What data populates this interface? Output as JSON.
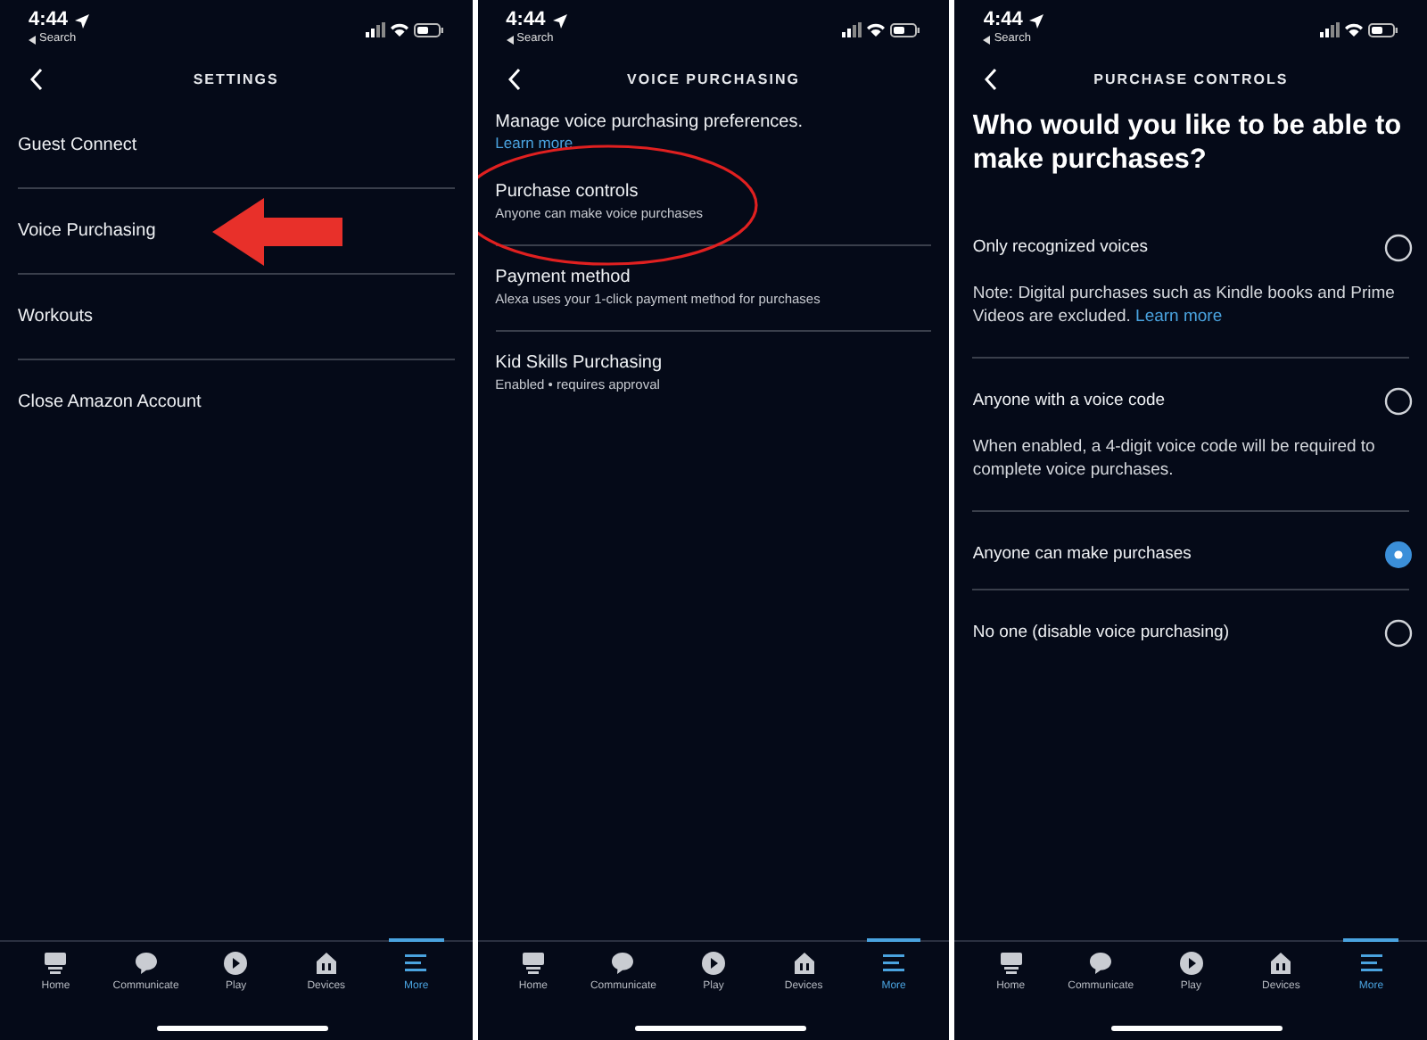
{
  "screens": [
    {
      "status": {
        "time": "4:44",
        "back_app": "Search"
      },
      "title": "SETTINGS",
      "blocks": [
        {
          "kind": "row",
          "title": "Guest Connect",
          "pointed_at": false
        },
        {
          "kind": "divider"
        },
        {
          "kind": "row",
          "title": "Voice Purchasing",
          "pointed_at": true
        },
        {
          "kind": "divider"
        },
        {
          "kind": "row",
          "title": "Workouts",
          "pointed_at": false
        },
        {
          "kind": "divider"
        },
        {
          "kind": "row",
          "title": "Close Amazon Account",
          "pointed_at": false
        }
      ],
      "tabs": [
        {
          "label": "Home",
          "kind": "home",
          "selected": false
        },
        {
          "label": "Communicate",
          "kind": "communicate",
          "selected": false
        },
        {
          "label": "Play",
          "kind": "play",
          "selected": false
        },
        {
          "label": "Devices",
          "kind": "devices",
          "selected": false
        },
        {
          "label": "More",
          "kind": "more",
          "selected": true
        }
      ]
    },
    {
      "status": {
        "time": "4:44",
        "back_app": "Search"
      },
      "title": "VOICE PURCHASING",
      "blocks": [
        {
          "kind": "intro",
          "text": "Manage voice purchasing preferences.",
          "link": "Learn more"
        },
        {
          "kind": "row",
          "title": "Purchase controls",
          "subtitle": "Anyone can make voice purchases",
          "circled": true
        },
        {
          "kind": "divider"
        },
        {
          "kind": "row",
          "title": "Payment method",
          "subtitle": "Alexa uses your 1-click payment method for purchases",
          "circled": false
        },
        {
          "kind": "divider"
        },
        {
          "kind": "row",
          "title": "Kid Skills Purchasing",
          "subtitle": "Enabled • requires approval",
          "circled": false
        }
      ],
      "tabs": [
        {
          "label": "Home",
          "kind": "home",
          "selected": false
        },
        {
          "label": "Communicate",
          "kind": "communicate",
          "selected": false
        },
        {
          "label": "Play",
          "kind": "play",
          "selected": false
        },
        {
          "label": "Devices",
          "kind": "devices",
          "selected": false
        },
        {
          "label": "More",
          "kind": "more",
          "selected": true
        }
      ]
    },
    {
      "status": {
        "time": "4:44",
        "back_app": "Search"
      },
      "title": "PURCHASE CONTROLS",
      "blocks": [
        {
          "kind": "heading",
          "text": "Who would you like to be able to make purchases?"
        },
        {
          "kind": "option",
          "label": "Only recognized voices",
          "selected": false
        },
        {
          "kind": "note",
          "text": "Note: Digital purchases such as Kindle books and Prime Videos are excluded.",
          "link": "Learn more"
        },
        {
          "kind": "divider"
        },
        {
          "kind": "option",
          "label": "Anyone with a voice code",
          "selected": false
        },
        {
          "kind": "note",
          "text": "When enabled, a 4-digit voice code will be required to complete voice purchases."
        },
        {
          "kind": "divider"
        },
        {
          "kind": "option",
          "label": "Anyone can make purchases",
          "selected": true
        },
        {
          "kind": "divider"
        },
        {
          "kind": "option",
          "label": "No one (disable voice purchasing)",
          "selected": false
        }
      ],
      "tabs": [
        {
          "label": "Home",
          "kind": "home",
          "selected": false
        },
        {
          "label": "Communicate",
          "kind": "communicate",
          "selected": false
        },
        {
          "label": "Play",
          "kind": "play",
          "selected": false
        },
        {
          "label": "Devices",
          "kind": "devices",
          "selected": false
        },
        {
          "label": "More",
          "kind": "more",
          "selected": true
        }
      ]
    }
  ]
}
